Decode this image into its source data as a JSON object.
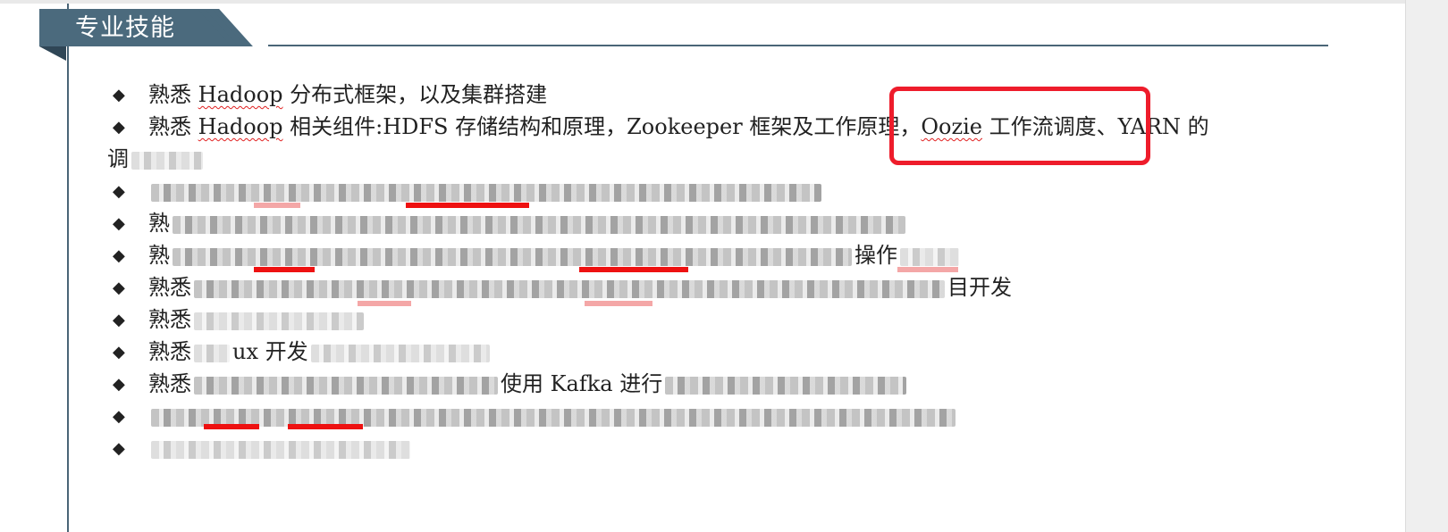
{
  "section": {
    "title": "专业技能"
  },
  "items": [
    {
      "prefix": "熟悉 ",
      "link": "Hadoop",
      "text": " 分布式框架，以及集群搭建"
    },
    {
      "prefix": "熟悉 ",
      "link": "Hadoop",
      "text": " 相关组件:HDFS 存储结构和原理，Zookeeper 框架及工作原理，",
      "link2": "Oozie",
      "text2": " 工作流调度、YARN 的",
      "cont": "调"
    },
    {
      "prefix": "",
      "text": ""
    },
    {
      "prefix": "熟",
      "text": ""
    },
    {
      "prefix": "熟",
      "text": "操作"
    },
    {
      "prefix": "熟悉",
      "text": "目开发"
    },
    {
      "prefix": "熟悉",
      "text": ""
    },
    {
      "prefix": "熟悉",
      "text": "ux 开发"
    },
    {
      "prefix": "熟悉",
      "text": "使用 Kafka 进行"
    },
    {
      "prefix": "",
      "text": ""
    },
    {
      "prefix": "",
      "text": ""
    }
  ],
  "bullet_symbol": "◆",
  "colors": {
    "banner": "#4b6a7d",
    "rule": "#4a6577",
    "highlight": "#ee1c2b",
    "spell_underline": "#e02020"
  }
}
